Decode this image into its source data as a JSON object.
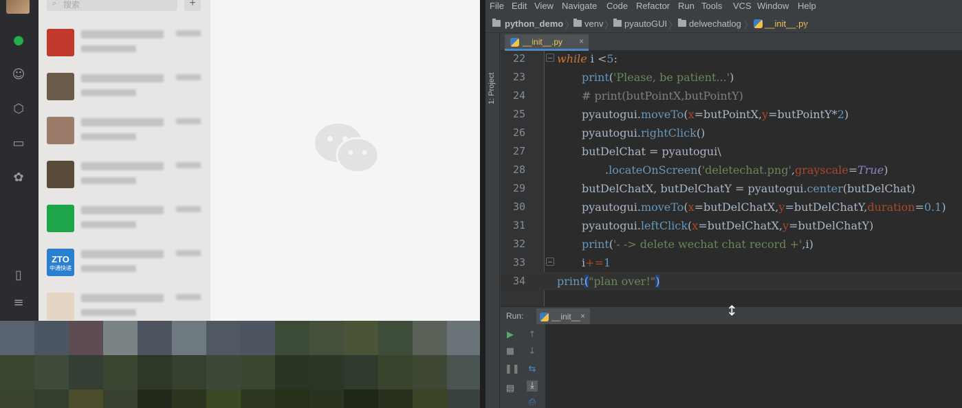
{
  "wechat": {
    "search_placeholder": "搜索",
    "add_button": "+",
    "chats": [
      {
        "avatar_color": "#c0392b"
      },
      {
        "avatar_color": "#6b5a4a"
      },
      {
        "avatar_color": "#9b7b6a"
      },
      {
        "avatar_color": "#5a4a3a"
      },
      {
        "avatar_color": "#1fa64a"
      },
      {
        "avatar_color": "#2b7fd1",
        "avatar_text": "ZTO",
        "avatar_sub": "中通快递"
      },
      {
        "avatar_color": "#e6d5c2"
      }
    ]
  },
  "ide": {
    "menu": [
      "File",
      "Edit",
      "View",
      "Navigate",
      "Code",
      "Refactor",
      "Run",
      "Tools",
      "VCS",
      "Window",
      "Help"
    ],
    "breadcrumbs": [
      "python_demo",
      "venv",
      "pyautoGUI",
      "delwechatlog",
      "__init__.py"
    ],
    "project_tool": "1: Project",
    "editor_tab": "__init__.py",
    "tab_close": "×",
    "lines": [
      "22",
      "23",
      "24",
      "25",
      "26",
      "27",
      "28",
      "29",
      "30",
      "31",
      "32",
      "33",
      "34"
    ],
    "run_label": "Run:",
    "run_tab": "__init__",
    "run_tab_close": "×"
  },
  "colors": {
    "accent": "#4a88c7",
    "wechat_green": "#22b04b"
  }
}
